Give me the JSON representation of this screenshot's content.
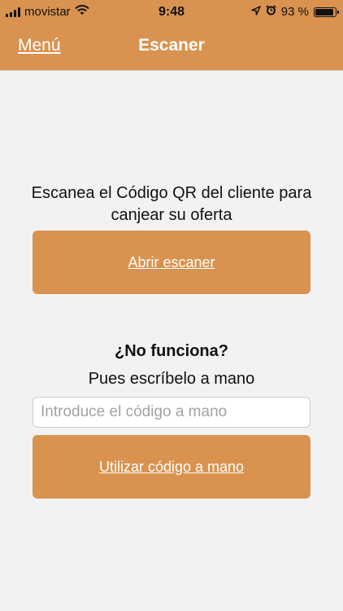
{
  "status_bar": {
    "carrier": "movistar",
    "time": "9:48",
    "battery": "93 %",
    "battery_level": 0.93,
    "icons": [
      "signal-icon",
      "wifi-icon",
      "location-icon",
      "alarm-icon",
      "battery-icon"
    ]
  },
  "nav": {
    "menu_label": "Menú",
    "title": "Escaner"
  },
  "main": {
    "instruction": "Escanea el Código QR del cliente para canjear su oferta",
    "scan_button": "Abrir escaner",
    "fallback_question": "¿No funciona?",
    "fallback_hint": "Pues escríbelo a mano",
    "code_input_placeholder": "Introduce el código a mano",
    "code_input_value": "",
    "manual_button": "Utilizar código a mano"
  },
  "colors": {
    "accent": "#d9924f",
    "background": "#f2f2f2"
  }
}
